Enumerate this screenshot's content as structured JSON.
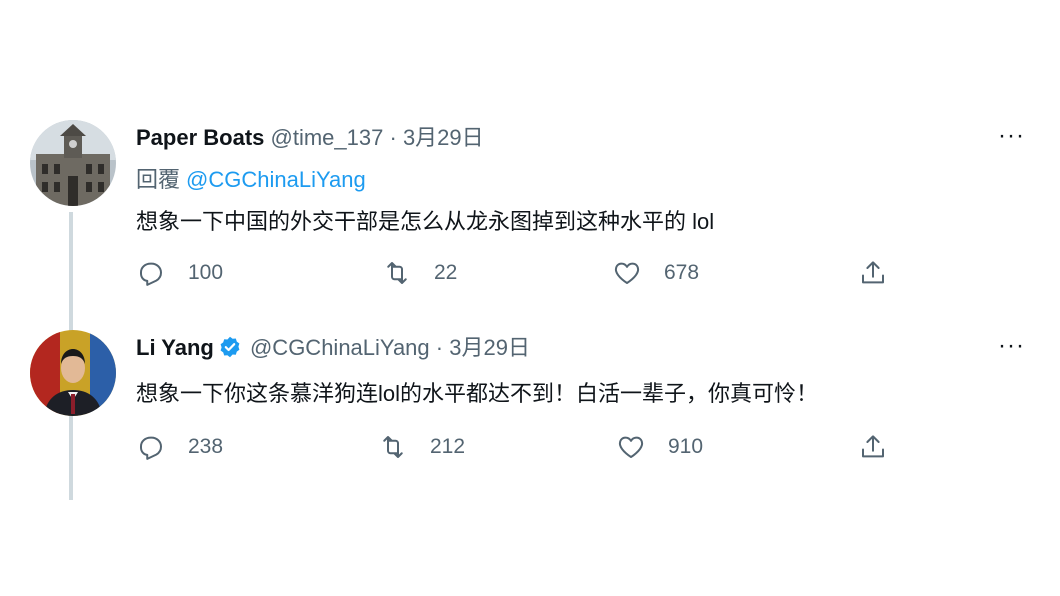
{
  "tweets": [
    {
      "name": "Paper Boats",
      "handle": "@time_137",
      "separator": "·",
      "date": "3月29日",
      "reply_label": "回覆",
      "reply_mention": "@CGChinaLiYang",
      "text": "想象一下中国的外交干部是怎么从龙永图掉到这种水平的 lol",
      "replies": "100",
      "retweets": "22",
      "likes": "678",
      "more": "···",
      "verified": false
    },
    {
      "name": "Li Yang",
      "handle": "@CGChinaLiYang",
      "separator": "·",
      "date": "3月29日",
      "text": "想象一下你这条慕洋狗连lol的水平都达不到！白活一辈子，你真可怜！",
      "replies": "238",
      "retweets": "212",
      "likes": "910",
      "more": "···",
      "verified": true
    }
  ],
  "colors": {
    "accent": "#1d9bf0",
    "secondary_text": "#536471",
    "primary_text": "#0f1419",
    "thread_line": "#cfd9de"
  },
  "icons": {
    "reply": "reply-icon",
    "retweet": "retweet-icon",
    "like": "heart-icon",
    "share": "share-icon",
    "verified": "verified-badge-icon"
  }
}
